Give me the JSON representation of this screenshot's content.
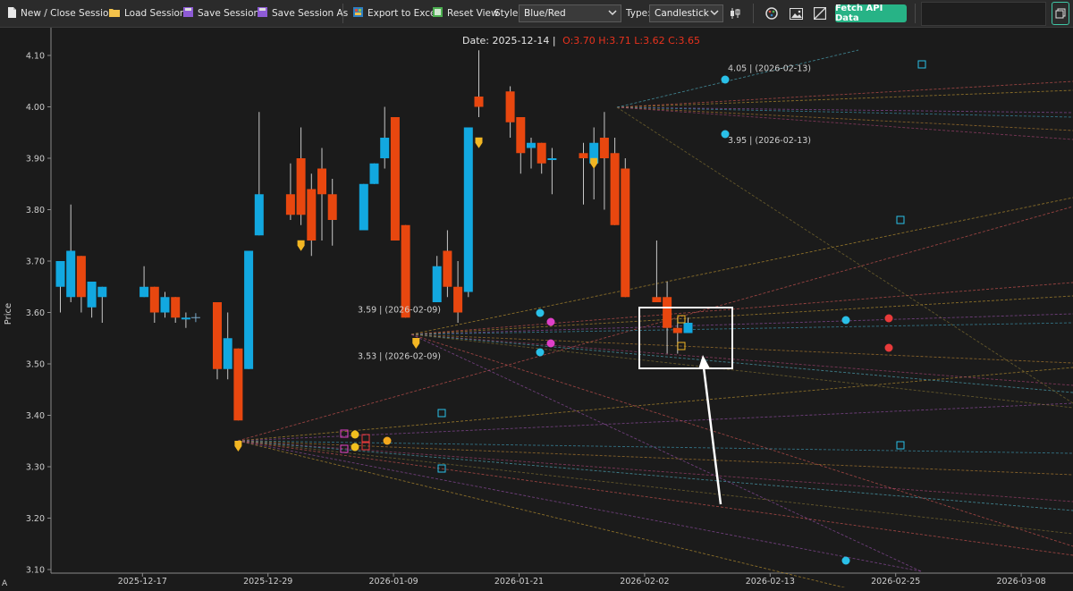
{
  "toolbar": {
    "new_close_session": "New / Close Session",
    "load_session": "Load Session",
    "save_session": "Save Session",
    "save_session_as": "Save Session As",
    "export_excel": "Export to Excel",
    "reset_view": "Reset View",
    "style_label": "Style:",
    "style_value": "Blue/Red",
    "type_label": "Type:",
    "type_value": "Candlestick",
    "fetch_api": "Fetch API Data"
  },
  "icons": [
    "document-icon",
    "folder-icon",
    "save-icon",
    "save-as-icon",
    "excel-icon",
    "reset-view-icon",
    "chevron-down-icon",
    "candles-icon",
    "color-wheel-icon",
    "image-icon",
    "diagonal-line-icon",
    "restore-icon"
  ],
  "colors": {
    "up": "#12a8e0",
    "down": "#e8470f",
    "marker": "#f2b623",
    "background": "#1b1b1b"
  },
  "chart_data": {
    "type": "candlestick",
    "info": {
      "date_text": "Date: 2025-12-14 |",
      "ohlc_text": "O:3.70 H:3.71 L:3.62 C:3.65",
      "ohlc_color": "#e8321d"
    },
    "ylabel": "Price",
    "ylim": [
      3.1,
      4.12
    ],
    "yticks": [
      "3.10",
      "3.20",
      "3.30",
      "3.40",
      "3.50",
      "3.60",
      "3.70",
      "3.80",
      "3.90",
      "4.00",
      "4.10"
    ],
    "xticks": [
      {
        "label": "2025-12-17",
        "slot": 4
      },
      {
        "label": "2025-12-29",
        "slot": 16
      },
      {
        "label": "2026-01-09",
        "slot": 28
      },
      {
        "label": "2026-01-21",
        "slot": 40
      },
      {
        "label": "2026-02-02",
        "slot": 52
      },
      {
        "label": "2026-02-13",
        "slot": 64
      },
      {
        "label": "2026-02-25",
        "slot": 76
      },
      {
        "label": "2026-03-08",
        "slot": 88
      }
    ],
    "candles": [
      {
        "slot": 0,
        "o": 3.65,
        "h": 3.69,
        "l": 3.6,
        "c": 3.7
      },
      {
        "slot": 1,
        "o": 3.63,
        "h": 3.81,
        "l": 3.62,
        "c": 3.72
      },
      {
        "slot": 2,
        "o": 3.71,
        "h": 3.71,
        "l": 3.6,
        "c": 3.63
      },
      {
        "slot": 3,
        "o": 3.61,
        "h": 3.65,
        "l": 3.59,
        "c": 3.66
      },
      {
        "slot": 4,
        "o": 3.63,
        "h": 3.65,
        "l": 3.58,
        "c": 3.65
      },
      {
        "slot": 8,
        "o": 3.63,
        "h": 3.69,
        "l": 3.63,
        "c": 3.65
      },
      {
        "slot": 9,
        "o": 3.65,
        "h": 3.65,
        "l": 3.58,
        "c": 3.6
      },
      {
        "slot": 10,
        "o": 3.6,
        "h": 3.64,
        "l": 3.59,
        "c": 3.63
      },
      {
        "slot": 11,
        "o": 3.63,
        "h": 3.63,
        "l": 3.58,
        "c": 3.59
      },
      {
        "slot": 12,
        "o": 3.59,
        "h": 3.6,
        "l": 3.57,
        "c": 3.59
      },
      {
        "slot": 15,
        "o": 3.62,
        "h": 3.62,
        "l": 3.47,
        "c": 3.49
      },
      {
        "slot": 16,
        "o": 3.49,
        "h": 3.6,
        "l": 3.47,
        "c": 3.55
      },
      {
        "slot": 17,
        "o": 3.53,
        "h": 3.53,
        "l": 3.39,
        "c": 3.39
      },
      {
        "slot": 18,
        "o": 3.49,
        "h": 3.72,
        "l": 3.49,
        "c": 3.72
      },
      {
        "slot": 19,
        "o": 3.75,
        "h": 3.99,
        "l": 3.75,
        "c": 3.83
      },
      {
        "slot": 22,
        "o": 3.83,
        "h": 3.89,
        "l": 3.78,
        "c": 3.79
      },
      {
        "slot": 23,
        "o": 3.9,
        "h": 3.96,
        "l": 3.77,
        "c": 3.79
      },
      {
        "slot": 24,
        "o": 3.84,
        "h": 3.87,
        "l": 3.71,
        "c": 3.74
      },
      {
        "slot": 25,
        "o": 3.88,
        "h": 3.92,
        "l": 3.74,
        "c": 3.83
      },
      {
        "slot": 26,
        "o": 3.83,
        "h": 3.86,
        "l": 3.73,
        "c": 3.78
      },
      {
        "slot": 29,
        "o": 3.76,
        "h": 3.85,
        "l": 3.76,
        "c": 3.85
      },
      {
        "slot": 30,
        "o": 3.85,
        "h": 3.89,
        "l": 3.85,
        "c": 3.89
      },
      {
        "slot": 31,
        "o": 3.9,
        "h": 4.0,
        "l": 3.88,
        "c": 3.94
      },
      {
        "slot": 32,
        "o": 3.98,
        "h": 3.98,
        "l": 3.74,
        "c": 3.74
      },
      {
        "slot": 33,
        "o": 3.77,
        "h": 3.77,
        "l": 3.59,
        "c": 3.59
      },
      {
        "slot": 36,
        "o": 3.62,
        "h": 3.71,
        "l": 3.62,
        "c": 3.69
      },
      {
        "slot": 37,
        "o": 3.72,
        "h": 3.76,
        "l": 3.63,
        "c": 3.65
      },
      {
        "slot": 38,
        "o": 3.65,
        "h": 3.7,
        "l": 3.58,
        "c": 3.6
      },
      {
        "slot": 39,
        "o": 3.64,
        "h": 3.96,
        "l": 3.63,
        "c": 3.96
      },
      {
        "slot": 40,
        "o": 4.02,
        "h": 4.11,
        "l": 3.98,
        "c": 4.0
      },
      {
        "slot": 43,
        "o": 4.03,
        "h": 4.04,
        "l": 3.94,
        "c": 3.97
      },
      {
        "slot": 44,
        "o": 3.98,
        "h": 3.98,
        "l": 3.87,
        "c": 3.91
      },
      {
        "slot": 45,
        "o": 3.92,
        "h": 3.94,
        "l": 3.88,
        "c": 3.93
      },
      {
        "slot": 46,
        "o": 3.93,
        "h": 3.93,
        "l": 3.87,
        "c": 3.89
      },
      {
        "slot": 47,
        "o": 3.9,
        "h": 3.92,
        "l": 3.83,
        "c": 3.9
      },
      {
        "slot": 50,
        "o": 3.91,
        "h": 3.93,
        "l": 3.81,
        "c": 3.9
      },
      {
        "slot": 51,
        "o": 3.89,
        "h": 3.96,
        "l": 3.82,
        "c": 3.93
      },
      {
        "slot": 52,
        "o": 3.94,
        "h": 3.99,
        "l": 3.8,
        "c": 3.9
      },
      {
        "slot": 53,
        "o": 3.91,
        "h": 3.94,
        "l": 3.77,
        "c": 3.77
      },
      {
        "slot": 54,
        "o": 3.88,
        "h": 3.9,
        "l": 3.63,
        "c": 3.63
      },
      {
        "slot": 57,
        "o": 3.63,
        "h": 3.74,
        "l": 3.62,
        "c": 3.62
      },
      {
        "slot": 58,
        "o": 3.63,
        "h": 3.66,
        "l": 3.52,
        "c": 3.57
      },
      {
        "slot": 59,
        "o": 3.57,
        "h": 3.59,
        "l": 3.52,
        "c": 3.56
      },
      {
        "slot": 60,
        "o": 3.56,
        "h": 3.59,
        "l": 3.56,
        "c": 3.58
      }
    ],
    "markers": [
      {
        "slot": 17,
        "price": 3.34
      },
      {
        "slot": 23,
        "price": 3.73
      },
      {
        "slot": 34,
        "price": 3.54
      },
      {
        "slot": 40,
        "price": 3.93
      },
      {
        "slot": 51,
        "price": 3.89
      }
    ],
    "price_labels": [
      {
        "text": "4.05 | (2026-02-13)",
        "slot": 58,
        "price": 4.07
      },
      {
        "text": "3.95 | (2026-02-13)",
        "slot": 58,
        "price": 3.93
      },
      {
        "text": "3.59 | (2026-02-09)",
        "slot": 29,
        "price": 3.6
      },
      {
        "text": "3.53 | (2026-02-09)",
        "slot": 29,
        "price": 3.51
      }
    ]
  }
}
